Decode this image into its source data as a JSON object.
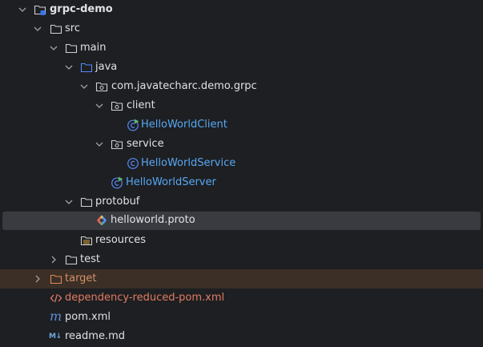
{
  "tree": {
    "root": "grpc-demo",
    "src": "src",
    "main": "main",
    "java": "java",
    "package": "com.javatecharc.demo.grpc",
    "client": "client",
    "hello_client": "HelloWorldClient",
    "service": "service",
    "hello_service": "HelloWorldService",
    "hello_server": "HelloWorldServer",
    "protobuf": "protobuf",
    "proto_file": "helloworld.proto",
    "resources": "resources",
    "test": "test",
    "target": "target",
    "dep_pom": "dependency-reduced-pom.xml",
    "pom": "pom.xml",
    "readme": "readme.md"
  },
  "colors": {
    "background": "#1e1f22",
    "selection": "#393b40",
    "excluded": "#3b2f26",
    "text": "#dfe1e5",
    "class_blue": "#56a8f5",
    "excluded_orange": "#d5916a",
    "ignored_red": "#e07c61"
  },
  "icons": {
    "module": "module-folder-icon",
    "folder": "folder-icon",
    "source_root": "source-root-folder-icon",
    "package": "package-icon",
    "runnable_class": "runnable-class-icon",
    "class": "class-icon",
    "proto": "protobuf-file-icon",
    "resources_root": "resources-root-folder-icon",
    "excluded_folder": "excluded-folder-icon",
    "xml": "xml-file-icon",
    "maven": "maven-icon",
    "markdown": "markdown-icon"
  }
}
